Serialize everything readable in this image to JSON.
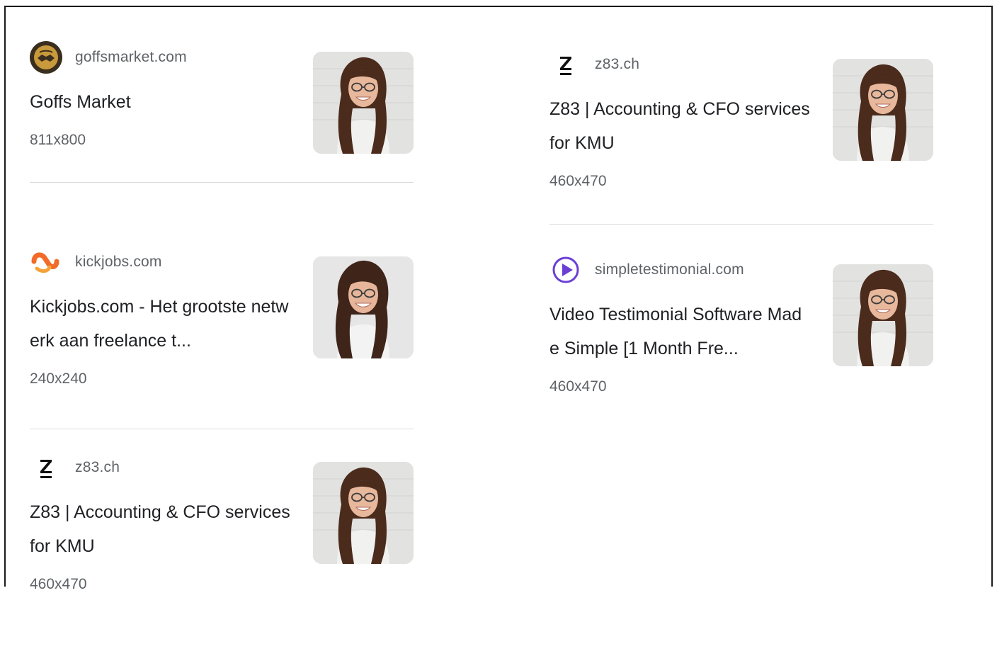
{
  "results_left": [
    {
      "domain": "goffsmarket.com",
      "favicon": "handshake-icon",
      "title": "Goffs Market",
      "size": "811x800"
    },
    {
      "domain": "kickjobs.com",
      "favicon": "orange-wave-icon",
      "title": "Kickjobs.com - Het grootste netwerk aan freelance t...",
      "size": "240x240"
    },
    {
      "domain": "z83.ch",
      "favicon": "z83-logo-icon",
      "title": "Z83 | Accounting & CFO services for KMU",
      "size": "460x470"
    }
  ],
  "results_right": [
    {
      "domain": "z83.ch",
      "favicon": "z83-logo-icon",
      "title": "Z83 | Accounting & CFO services for KMU",
      "size": "460x470"
    },
    {
      "domain": "simpletestimonial.com",
      "favicon": "play-circle-icon",
      "title": "Video Testimonial Software Made Simple [1 Month Fre...",
      "size": "460x470"
    }
  ],
  "colors": {
    "title": "#202124",
    "meta": "#5f6368",
    "divider": "#dadce0",
    "goffs_favicon": "#3a2e1f",
    "kickjobs_orange": "#f26b2a",
    "simpletestimonial_purple": "#6b3fd6"
  }
}
